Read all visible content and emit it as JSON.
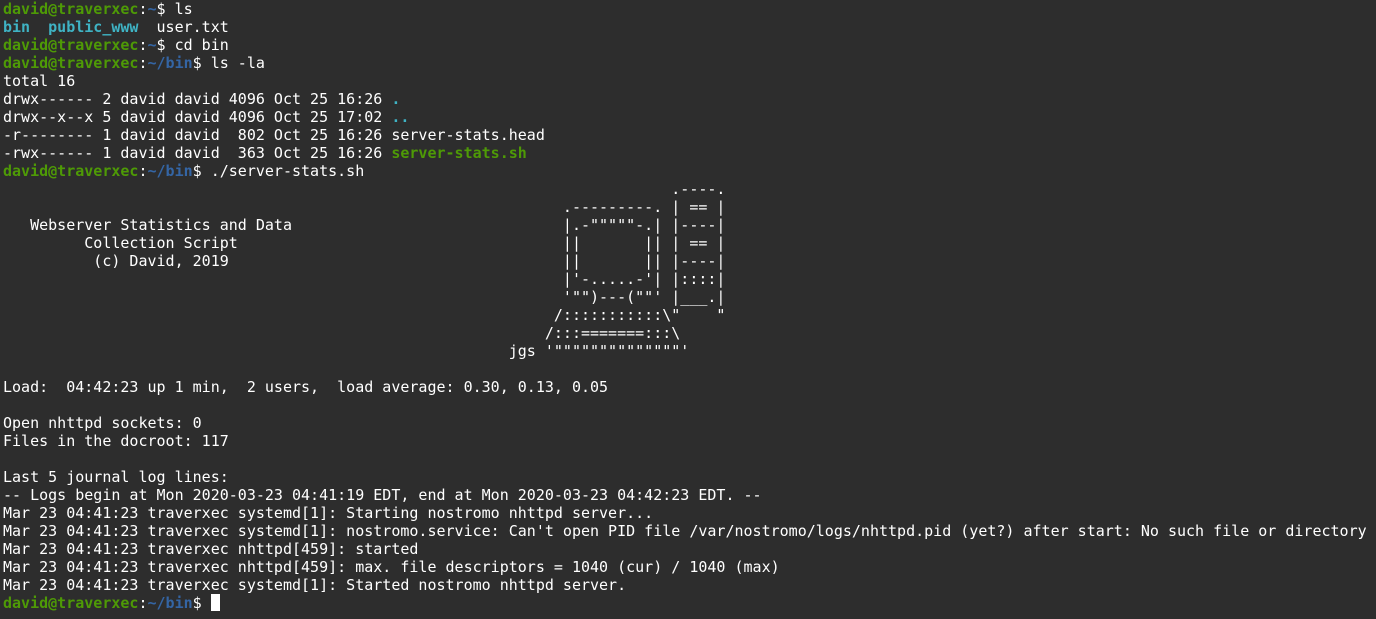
{
  "terminal": {
    "colors": {
      "background": "#2d2d2d",
      "text": "#ffffff",
      "prompt_user": "#4e9a06",
      "prompt_path": "#3465a4",
      "directory": "#3fb3c4",
      "executable": "#4e9a06"
    },
    "prompts": {
      "p1": {
        "userhost": "david@traverxec",
        "colon": ":",
        "path": "~",
        "symbol": "$ ",
        "command": "ls"
      },
      "p2": {
        "userhost": "david@traverxec",
        "colon": ":",
        "path": "~",
        "symbol": "$ ",
        "command": "cd bin"
      },
      "p3": {
        "userhost": "david@traverxec",
        "colon": ":",
        "path": "~/bin",
        "symbol": "$ ",
        "command": "ls -la"
      },
      "p4": {
        "userhost": "david@traverxec",
        "colon": ":",
        "path": "~/bin",
        "symbol": "$ ",
        "command": "./server-stats.sh"
      },
      "p5": {
        "userhost": "david@traverxec",
        "colon": ":",
        "path": "~/bin",
        "symbol": "$ ",
        "command": ""
      }
    },
    "ls_output": {
      "bin": "bin",
      "sep1": "  ",
      "public_www": "public_www",
      "sep2": "  ",
      "user_txt": "user.txt"
    },
    "ls_la": {
      "total": "total 16",
      "rows": [
        {
          "meta": "drwx------ 2 david david 4096 Oct 25 16:26 ",
          "name": "."
        },
        {
          "meta": "drwx--x--x 5 david david 4096 Oct 25 17:02 ",
          "name": ".."
        },
        {
          "meta": "-r-------- 1 david david  802 Oct 25 16:26 ",
          "name": "server-stats.head"
        },
        {
          "meta": "-rwx------ 1 david david  363 Oct 25 16:26 ",
          "name": "server-stats.sh"
        }
      ]
    },
    "banner": [
      "                                                                          .----.",
      "                                                              .---------. | == |",
      "   Webserver Statistics and Data                              |.-\"\"\"\"\"-.| |----|",
      "         Collection Script                                    ||       || | == |",
      "          (c) David, 2019                                     ||       || |----|",
      "                                                              |'-.....-'| |::::|",
      "                                                              '\"\")---(\"\"' |___.|",
      "                                                             /:::::::::::\\\"    \"",
      "                                                            /:::=======:::\\",
      "                                                        jgs '\"\"\"\"\"\"\"\"\"\"\"\"\"\"'"
    ],
    "stats": {
      "load": "Load:  04:42:23 up 1 min,  2 users,  load average: 0.30, 0.13, 0.05",
      "sockets": "Open nhttpd sockets: 0",
      "files": "Files in the docroot: 117"
    },
    "journal": {
      "header": "Last 5 journal log lines:",
      "lines": [
        "-- Logs begin at Mon 2020-03-23 04:41:19 EDT, end at Mon 2020-03-23 04:42:23 EDT. --",
        "Mar 23 04:41:23 traverxec systemd[1]: Starting nostromo nhttpd server...",
        "Mar 23 04:41:23 traverxec systemd[1]: nostromo.service: Can't open PID file /var/nostromo/logs/nhttpd.pid (yet?) after start: No such file or directory",
        "Mar 23 04:41:23 traverxec nhttpd[459]: started",
        "Mar 23 04:41:23 traverxec nhttpd[459]: max. file descriptors = 1040 (cur) / 1040 (max)",
        "Mar 23 04:41:23 traverxec systemd[1]: Started nostromo nhttpd server."
      ]
    }
  }
}
